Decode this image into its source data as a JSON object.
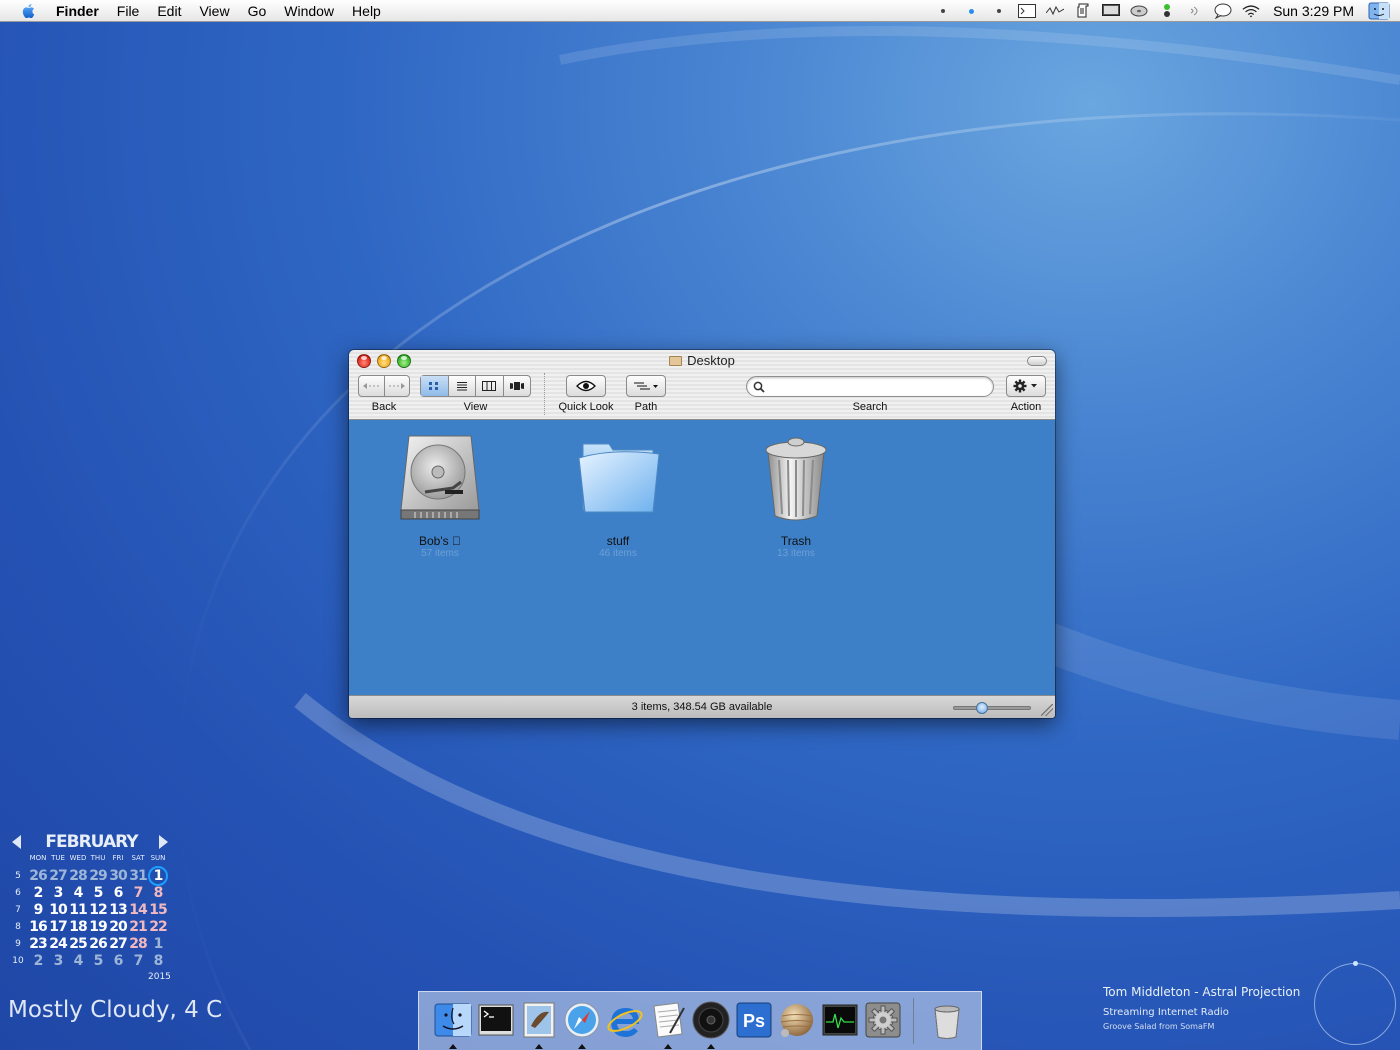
{
  "menubar": {
    "app": "Finder",
    "items": [
      "File",
      "Edit",
      "View",
      "Go",
      "Window",
      "Help"
    ],
    "clock": "Sun 3:29 PM"
  },
  "window": {
    "title": "Desktop",
    "toolbar": {
      "back_label": "Back",
      "view_label": "View",
      "quicklook_label": "Quick Look",
      "path_label": "Path",
      "search_label": "Search",
      "action_label": "Action",
      "search_value": "",
      "active_view": "icon"
    },
    "items": [
      {
        "name": "Bob's ",
        "count": "57 items",
        "icon": "hard-drive-icon"
      },
      {
        "name": "stuff",
        "count": "46 items",
        "icon": "folder-icon"
      },
      {
        "name": "Trash",
        "count": "13 items",
        "icon": "trash-icon"
      }
    ],
    "status": "3 items, 348.54 GB available",
    "icon_size": 0.35
  },
  "calendar": {
    "month": "FEBRUARY",
    "year": "2015",
    "day_headers": [
      "MON",
      "TUE",
      "WED",
      "THU",
      "FRI",
      "SAT",
      "SUN"
    ],
    "weeks": [
      {
        "wk": "5",
        "days": [
          "26",
          "27",
          "28",
          "29",
          "30",
          "31",
          "1"
        ]
      },
      {
        "wk": "6",
        "days": [
          "2",
          "3",
          "4",
          "5",
          "6",
          "7",
          "8"
        ]
      },
      {
        "wk": "7",
        "days": [
          "9",
          "10",
          "11",
          "12",
          "13",
          "14",
          "15"
        ]
      },
      {
        "wk": "8",
        "days": [
          "16",
          "17",
          "18",
          "19",
          "20",
          "21",
          "22"
        ]
      },
      {
        "wk": "9",
        "days": [
          "23",
          "24",
          "25",
          "26",
          "27",
          "28",
          "1"
        ]
      },
      {
        "wk": "10",
        "days": [
          "2",
          "3",
          "4",
          "5",
          "6",
          "7",
          "8"
        ]
      }
    ],
    "today": "1"
  },
  "weather": "Mostly Cloudy, 4 C",
  "now_playing": {
    "track": "Tom Middleton - Astral Projection",
    "station": "Streaming Internet Radio",
    "subtitle": "Groove Salad from SomaFM"
  },
  "dock": {
    "apps": [
      "finder-icon",
      "terminal-icon",
      "mail-icon",
      "safari-icon",
      "internet-explorer-icon",
      "textedit-icon",
      "speaker-icon",
      "photoshop-icon",
      "planet-icon",
      "activity-monitor-icon",
      "system-preferences-icon"
    ],
    "trash": "trash-icon"
  },
  "colors": {
    "desktop": "#2f67c4",
    "window_background": "#3d80c8",
    "accent": "#1aa0ff"
  }
}
